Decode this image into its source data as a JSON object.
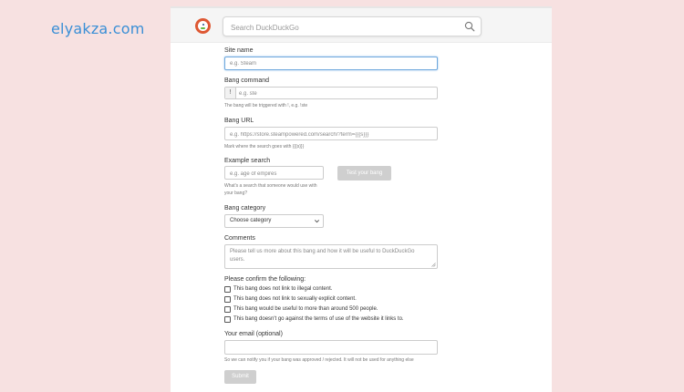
{
  "watermark": "elyakza.com",
  "header": {
    "logo_icon": "duckduckgo-logo-icon",
    "search_placeholder": "Search DuckDuckGo"
  },
  "form": {
    "site_name": {
      "label": "Site name",
      "placeholder": "e.g. Steam"
    },
    "bang_command": {
      "label": "Bang command",
      "prefix": "!",
      "placeholder": "e.g. ste",
      "hint": "The bang will be triggered with !, e.g. !ste"
    },
    "bang_url": {
      "label": "Bang URL",
      "placeholder": "e.g. https://store.steampowered.com/search/?term={{{s}}}",
      "hint": "Mark where the search goes with {{{s}}}"
    },
    "example_search": {
      "label": "Example search",
      "placeholder": "e.g. age of empires",
      "hint_line1": "What's a search that someone would use with",
      "hint_line2": "your bang?",
      "test_button": "Test your bang"
    },
    "bang_category": {
      "label": "Bang category",
      "selected": "Choose category"
    },
    "comments": {
      "label": "Comments",
      "placeholder": "Please tell us more about this bang and how it will be useful to DuckDuckGo users."
    },
    "confirm": {
      "label": "Please confirm the following:",
      "items": [
        "This bang does not link to illegal content.",
        "This bang does not link to sexually explicit content.",
        "This bang would be useful to more than around 500 people.",
        "This bang doesn't go against the terms of use of the website it links to."
      ]
    },
    "email": {
      "label": "Your email (optional)",
      "hint": "So we can notify you if your bang was approved / rejected. It will not be used for anything else"
    },
    "submit": "Submit"
  },
  "colors": {
    "background": "#f7e1e1",
    "accent": "#6fa8dc",
    "watermark": "#3a8fd6",
    "logo": "#de5833"
  }
}
